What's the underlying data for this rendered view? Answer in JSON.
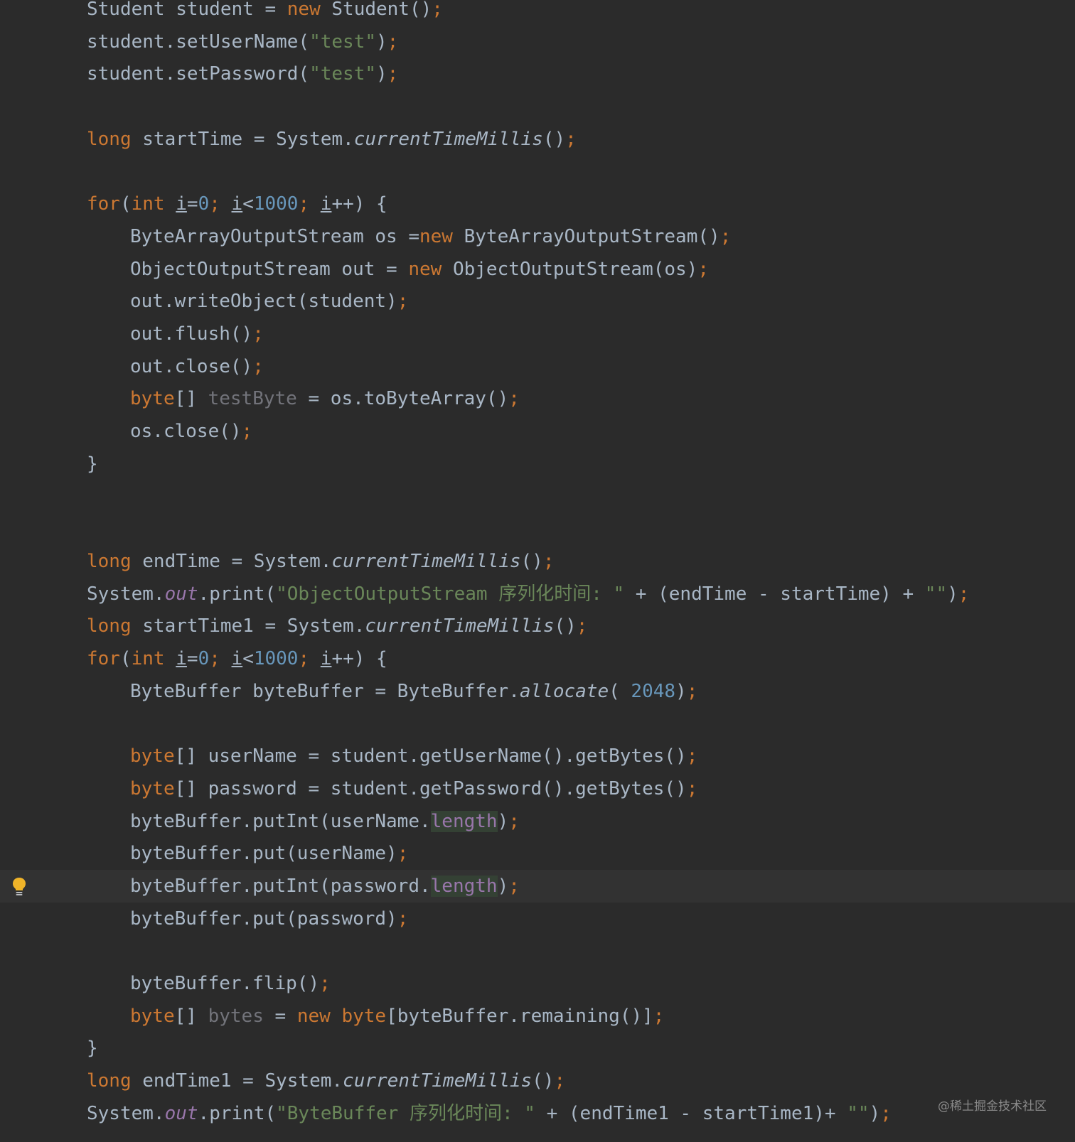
{
  "colors": {
    "background": "#2b2b2b",
    "current_line": "#323232",
    "default_text": "#a9b7c6",
    "keyword": "#cc7832",
    "string": "#6a8759",
    "number": "#6897bb",
    "field": "#9876aa",
    "unused": "#72737a",
    "highlight": "#344134",
    "bulb": "#f0b429"
  },
  "gutter": {
    "intention_icon": "lightbulb-icon"
  },
  "lines": [
    [
      {
        "t": "Student student = "
      },
      {
        "t": "new",
        "c": "kw"
      },
      {
        "t": " Student()"
      },
      {
        "t": ";",
        "c": "kw"
      }
    ],
    [
      {
        "t": "student.setUserName("
      },
      {
        "t": "\"test\"",
        "c": "str"
      },
      {
        "t": ")"
      },
      {
        "t": ";",
        "c": "kw"
      }
    ],
    [
      {
        "t": "student.setPassword("
      },
      {
        "t": "\"test\"",
        "c": "str"
      },
      {
        "t": ")"
      },
      {
        "t": ";",
        "c": "kw"
      }
    ],
    [],
    [
      {
        "t": "long",
        "c": "kw"
      },
      {
        "t": " startTime = System."
      },
      {
        "t": "currentTimeMillis",
        "c": "ital"
      },
      {
        "t": "()"
      },
      {
        "t": ";",
        "c": "kw"
      }
    ],
    [],
    [
      {
        "t": "for",
        "c": "kw"
      },
      {
        "t": "("
      },
      {
        "t": "int",
        "c": "kw"
      },
      {
        "t": " "
      },
      {
        "t": "i",
        "c": "ul"
      },
      {
        "t": "="
      },
      {
        "t": "0",
        "c": "num"
      },
      {
        "t": ";",
        "c": "kw"
      },
      {
        "t": " "
      },
      {
        "t": "i",
        "c": "ul"
      },
      {
        "t": "<"
      },
      {
        "t": "1000",
        "c": "num"
      },
      {
        "t": ";",
        "c": "kw"
      },
      {
        "t": " "
      },
      {
        "t": "i",
        "c": "ul"
      },
      {
        "t": "++) {"
      }
    ],
    [
      {
        "t": "ByteArrayOutputStream os ="
      },
      {
        "t": "new",
        "c": "kw"
      },
      {
        "t": " ByteArrayOutputStream()"
      },
      {
        "t": ";",
        "c": "kw"
      }
    ],
    [
      {
        "t": "ObjectOutputStream out = "
      },
      {
        "t": "new",
        "c": "kw"
      },
      {
        "t": " ObjectOutputStream(os)"
      },
      {
        "t": ";",
        "c": "kw"
      }
    ],
    [
      {
        "t": "out.writeObject(student)"
      },
      {
        "t": ";",
        "c": "kw"
      }
    ],
    [
      {
        "t": "out.flush()"
      },
      {
        "t": ";",
        "c": "kw"
      }
    ],
    [
      {
        "t": "out.close()"
      },
      {
        "t": ";",
        "c": "kw"
      }
    ],
    [
      {
        "t": "byte",
        "c": "kw"
      },
      {
        "t": "[] "
      },
      {
        "t": "testByte",
        "c": "unused"
      },
      {
        "t": " = os.toByteArray()"
      },
      {
        "t": ";",
        "c": "kw"
      }
    ],
    [
      {
        "t": "os.close()"
      },
      {
        "t": ";",
        "c": "kw"
      }
    ],
    [
      {
        "t": "}"
      }
    ],
    [],
    [],
    [
      {
        "t": "long",
        "c": "kw"
      },
      {
        "t": " endTime = System."
      },
      {
        "t": "currentTimeMillis",
        "c": "ital"
      },
      {
        "t": "()"
      },
      {
        "t": ";",
        "c": "kw"
      }
    ],
    [
      {
        "t": "System."
      },
      {
        "t": "out",
        "c": "fld ital"
      },
      {
        "t": ".print("
      },
      {
        "t": "\"ObjectOutputStream 序列化时间: \"",
        "c": "str"
      },
      {
        "t": " + (endTime - startTime) + "
      },
      {
        "t": "\"\"",
        "c": "str"
      },
      {
        "t": ")"
      },
      {
        "t": ";",
        "c": "kw"
      }
    ],
    [
      {
        "t": "long",
        "c": "kw"
      },
      {
        "t": " startTime1 = System."
      },
      {
        "t": "currentTimeMillis",
        "c": "ital"
      },
      {
        "t": "()"
      },
      {
        "t": ";",
        "c": "kw"
      }
    ],
    [
      {
        "t": "for",
        "c": "kw"
      },
      {
        "t": "("
      },
      {
        "t": "int",
        "c": "kw"
      },
      {
        "t": " "
      },
      {
        "t": "i",
        "c": "ul"
      },
      {
        "t": "="
      },
      {
        "t": "0",
        "c": "num"
      },
      {
        "t": ";",
        "c": "kw"
      },
      {
        "t": " "
      },
      {
        "t": "i",
        "c": "ul"
      },
      {
        "t": "<"
      },
      {
        "t": "1000",
        "c": "num"
      },
      {
        "t": ";",
        "c": "kw"
      },
      {
        "t": " "
      },
      {
        "t": "i",
        "c": "ul"
      },
      {
        "t": "++) {"
      }
    ],
    [
      {
        "t": "ByteBuffer byteBuffer = ByteBuffer."
      },
      {
        "t": "allocate",
        "c": "ital"
      },
      {
        "t": "( "
      },
      {
        "t": "2048",
        "c": "num"
      },
      {
        "t": ")"
      },
      {
        "t": ";",
        "c": "kw"
      }
    ],
    [],
    [
      {
        "t": "byte",
        "c": "kw"
      },
      {
        "t": "[] userName = student.getUserName().getBytes()"
      },
      {
        "t": ";",
        "c": "kw"
      }
    ],
    [
      {
        "t": "byte",
        "c": "kw"
      },
      {
        "t": "[] password = student.getPassword().getBytes()"
      },
      {
        "t": ";",
        "c": "kw"
      }
    ],
    [
      {
        "t": "byteBuffer.putInt(userName."
      },
      {
        "t": "length",
        "c": "fld hl"
      },
      {
        "t": ")"
      },
      {
        "t": ";",
        "c": "kw"
      }
    ],
    [
      {
        "t": "byteBuffer.put(userName)"
      },
      {
        "t": ";",
        "c": "kw"
      }
    ],
    [
      {
        "t": "byteBuffer.putInt(password."
      },
      {
        "t": "length",
        "c": "fld hl"
      },
      {
        "t": ")"
      },
      {
        "t": ";",
        "c": "kw"
      }
    ],
    [
      {
        "t": "byteBuffer.put(password)"
      },
      {
        "t": ";",
        "c": "kw"
      }
    ],
    [],
    [
      {
        "t": "byteBuffer.flip()"
      },
      {
        "t": ";",
        "c": "kw"
      }
    ],
    [
      {
        "t": "byte",
        "c": "kw"
      },
      {
        "t": "[] "
      },
      {
        "t": "bytes",
        "c": "unused"
      },
      {
        "t": " = "
      },
      {
        "t": "new",
        "c": "kw"
      },
      {
        "t": " "
      },
      {
        "t": "byte",
        "c": "kw"
      },
      {
        "t": "[byteBuffer.remaining()]"
      },
      {
        "t": ";",
        "c": "kw"
      }
    ],
    [
      {
        "t": "}"
      }
    ],
    [
      {
        "t": "long",
        "c": "kw"
      },
      {
        "t": " endTime1 = System."
      },
      {
        "t": "currentTimeMillis",
        "c": "ital"
      },
      {
        "t": "()"
      },
      {
        "t": ";",
        "c": "kw"
      }
    ],
    [
      {
        "t": "System."
      },
      {
        "t": "out",
        "c": "fld ital"
      },
      {
        "t": ".print("
      },
      {
        "t": "\"ByteBuffer 序列化时间: \"",
        "c": "str"
      },
      {
        "t": " + (endTime1 - startTime1)+ "
      },
      {
        "t": "\"\"",
        "c": "str"
      },
      {
        "t": ")"
      },
      {
        "t": ";",
        "c": "kw"
      }
    ]
  ],
  "watermark": "@稀土掘金技术社区"
}
